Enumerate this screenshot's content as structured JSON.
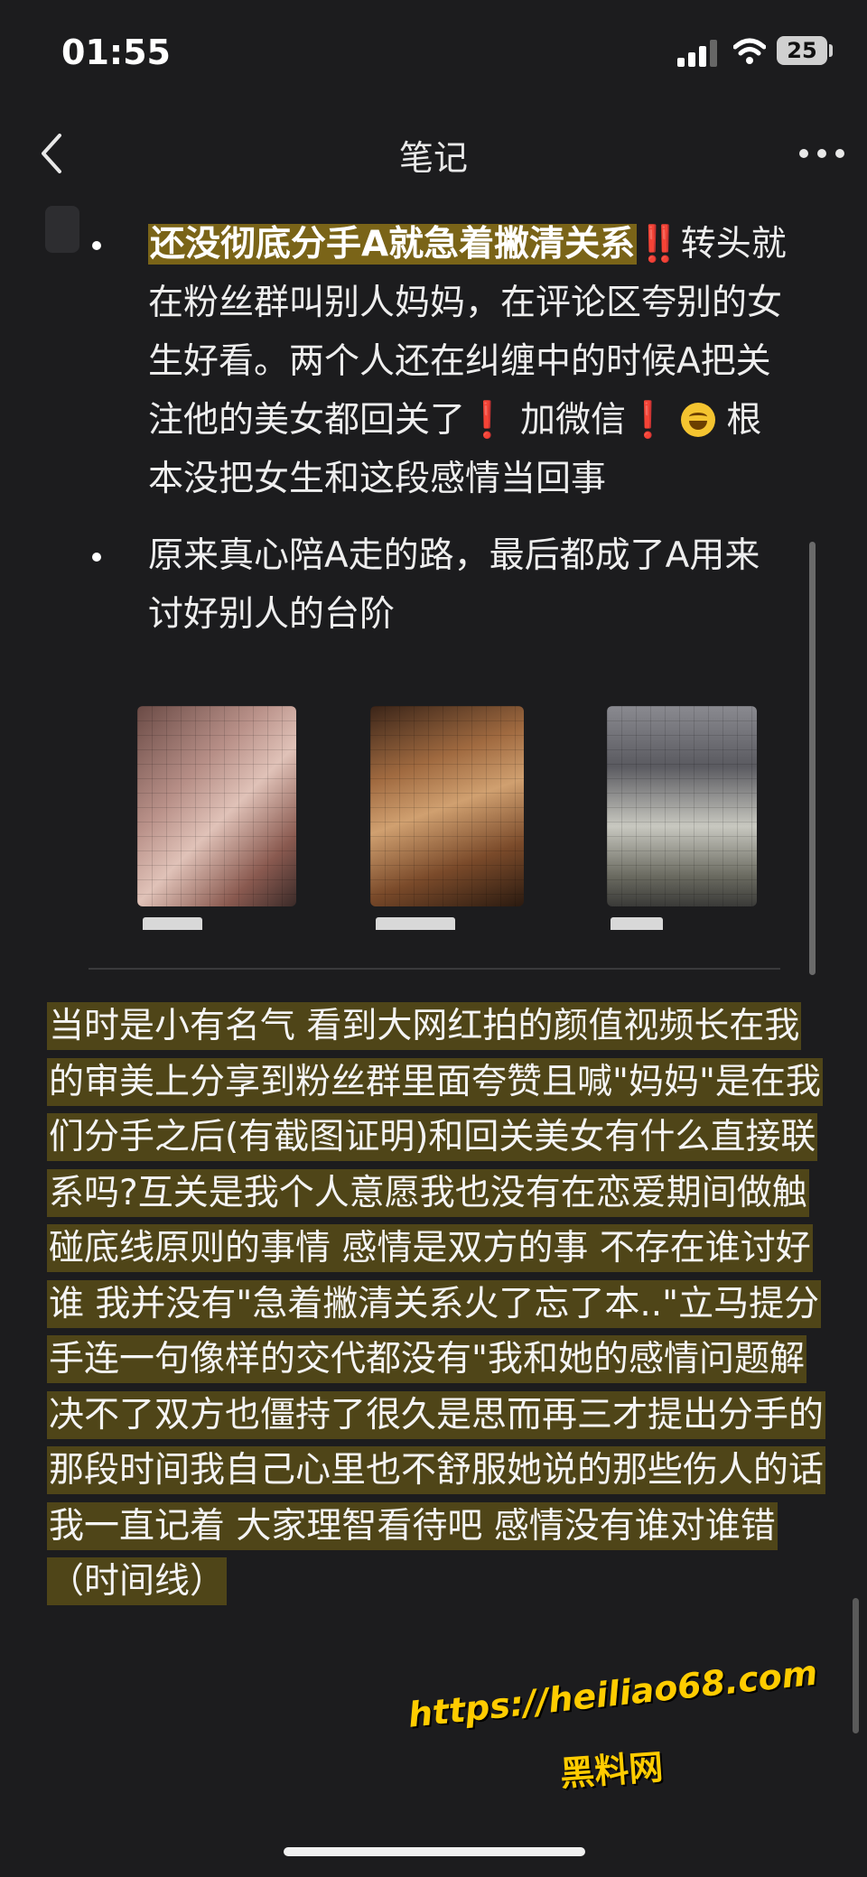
{
  "status_bar": {
    "time": "01:55",
    "battery": "25"
  },
  "nav": {
    "title": "笔记"
  },
  "note": {
    "bullets": [
      {
        "highlight": "还没彻底分手A就急着撇清关系",
        "double_exclaim": "‼️",
        "text_a": "转头就在粉丝群叫别人妈妈，在评论区夸别的女生好看。两个人还在纠缠中的时候A把关注他的美女都回关了",
        "exclaim_1": "❗",
        "text_b": " 加微信",
        "exclaim_2": "❗",
        "text_c": " 根本没把女生和这段感情当回事"
      },
      {
        "text": "原来真心陪A走的路，最后都成了A用来讨好别人的台阶"
      }
    ],
    "photos": [
      {
        "icon": "blurred-woman-portrait"
      },
      {
        "icon": "blurred-woman-selfie"
      },
      {
        "icon": "blurred-woman-full-body"
      }
    ]
  },
  "reply": {
    "text": "当时是小有名气 看到大网红拍的颜值视频长在我的审美上分享到粉丝群里面夸赞且喊\"妈妈\"是在我们分手之后(有截图证明)和回关美女有什么直接联系吗?互关是我个人意愿我也没有在恋爱期间做触碰底线原则的事情 感情是双方的事 不存在谁讨好谁 我并没有\"急着撇清关系火了忘了本..\"立马提分手连一句像样的交代都没有\"我和她的感情问题解决不了双方也僵持了很久是思而再三才提出分手的 那段时间我自己心里也不舒服她说的那些伤人的话我一直记着 大家理智看待吧 感情没有谁对谁错（时间线）"
  },
  "watermark": {
    "url": "https://heiliao68.com",
    "name": "黑料网"
  },
  "colors": {
    "background": "#1c1c1e",
    "highlight_gold": "#7a6418",
    "reply_highlight": "#4f4518",
    "accent_red": "#ff3b30"
  }
}
